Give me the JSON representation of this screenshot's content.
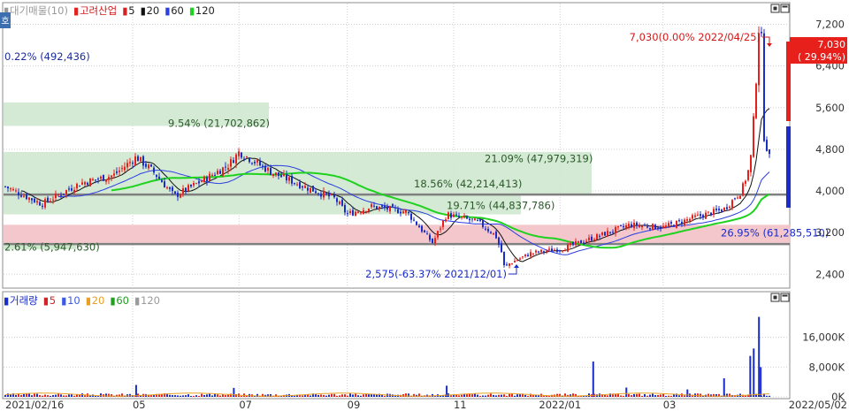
{
  "colors": {
    "up": "#e8201c",
    "down": "#1b2dc8",
    "ma5": "#d42222",
    "ma20": "#111111",
    "ma60": "#2a3ee0",
    "ma120": "#1fd21f",
    "vol10": "#3a5ae8",
    "vol20": "#e8a020",
    "vol60": "#20a020",
    "vol120": "#9a9a9a",
    "profile_band": "#cfe8cf",
    "pink_band": "#f2c4c8",
    "grid": "#cfcfcf",
    "sr_line": "#808080"
  },
  "price_panel": {
    "legend": [
      {
        "marker": "▮",
        "text": "대기매물(10)",
        "color": "#999999"
      },
      {
        "marker": "▮",
        "text": "고려산업",
        "color": "#e8201c"
      },
      {
        "marker": "▮",
        "text": "5",
        "color": "#d42222"
      },
      {
        "marker": "▮",
        "text": "20",
        "color": "#111111"
      },
      {
        "marker": "▮",
        "text": "60",
        "color": "#2a3ee0"
      },
      {
        "marker": "▮",
        "text": "120",
        "color": "#1fd21f"
      }
    ],
    "side_tab": "호",
    "top_left_note": "0.22% (492,436)",
    "profile_labels": [
      {
        "text": "9.54% (21,702,862)",
        "price": 5300
      },
      {
        "text": "21.09% (47,979,319)",
        "price": 4620
      },
      {
        "text": "18.56% (42,214,413)",
        "price": 4140
      },
      {
        "text": "19.71% (44,837,786)",
        "price": 3720
      },
      {
        "text": "2.61% (5,947,630)",
        "price": 2920
      },
      {
        "text": "26.95% (61,285,510)",
        "price": 3190
      }
    ],
    "high_annotation": "7,030(0.00% 2022/04/25)",
    "low_annotation": "2,575(-63.37% 2021/12/01)",
    "price_tag_value": "7,030",
    "price_tag_change": "( 29.94%)"
  },
  "volume_panel": {
    "legend": [
      {
        "marker": "▮",
        "text": "거래량",
        "color": "#1b2dc8"
      },
      {
        "marker": "▮",
        "text": "5",
        "color": "#d42222"
      },
      {
        "marker": "▮",
        "text": "10",
        "color": "#3a5ae8"
      },
      {
        "marker": "▮",
        "text": "20",
        "color": "#e8a020"
      },
      {
        "marker": "▮",
        "text": "60",
        "color": "#20a020"
      },
      {
        "marker": "▮",
        "text": "120",
        "color": "#9a9a9a"
      }
    ]
  },
  "x_axis_labels": [
    "2021/02/16",
    "05",
    "07",
    "09",
    "11",
    "2022/01",
    "03",
    "2022/05/02"
  ],
  "chart_data": [
    {
      "type": "candlestick",
      "title": "고려산업",
      "x_start": "2021-02-16",
      "x_end": "2022-05-02",
      "y_axis_ticks": [
        "7,200",
        "6,400",
        "5,600",
        "4,800",
        "4,000",
        "3,200",
        "2,400"
      ],
      "ylim": [
        2150,
        7600
      ],
      "key_points": [
        {
          "date": "2021-02-16",
          "close": 4100
        },
        {
          "date": "2021-03-10",
          "close": 3750
        },
        {
          "date": "2021-04-01",
          "close": 4150
        },
        {
          "date": "2021-04-20",
          "close": 4300
        },
        {
          "date": "2021-05-03",
          "close": 4650
        },
        {
          "date": "2021-05-12",
          "close": 4400
        },
        {
          "date": "2021-05-25",
          "close": 3900
        },
        {
          "date": "2021-06-10",
          "close": 4200
        },
        {
          "date": "2021-06-25",
          "close": 4500
        },
        {
          "date": "2021-07-01",
          "close": 4750
        },
        {
          "date": "2021-07-20",
          "close": 4350
        },
        {
          "date": "2021-08-10",
          "close": 4050
        },
        {
          "date": "2021-08-25",
          "close": 3850
        },
        {
          "date": "2021-09-01",
          "close": 3550
        },
        {
          "date": "2021-09-15",
          "close": 3700
        },
        {
          "date": "2021-10-05",
          "close": 3600
        },
        {
          "date": "2021-10-20",
          "close": 3000
        },
        {
          "date": "2021-10-28",
          "close": 3550
        },
        {
          "date": "2021-11-15",
          "close": 3400
        },
        {
          "date": "2021-11-25",
          "close": 3150
        },
        {
          "date": "2021-12-01",
          "close": 2575
        },
        {
          "date": "2021-12-15",
          "close": 2800
        },
        {
          "date": "2022-01-03",
          "close": 2900
        },
        {
          "date": "2022-01-20",
          "close": 3100
        },
        {
          "date": "2022-02-10",
          "close": 3350
        },
        {
          "date": "2022-03-01",
          "close": 3300
        },
        {
          "date": "2022-03-20",
          "close": 3500
        },
        {
          "date": "2022-04-05",
          "close": 3650
        },
        {
          "date": "2022-04-15",
          "close": 4000
        },
        {
          "date": "2022-04-20",
          "close": 4500
        },
        {
          "date": "2022-04-22",
          "close": 5410
        },
        {
          "date": "2022-04-25",
          "close": 7030
        },
        {
          "date": "2022-04-26",
          "close": 5300
        },
        {
          "date": "2022-05-02",
          "close": 4500
        }
      ],
      "high": {
        "date": "2022-04-25",
        "value": 7030,
        "pct": "0.00%"
      },
      "low": {
        "date": "2021-12-01",
        "value": 2575,
        "pct": "-63.37%"
      },
      "volume_profile": [
        {
          "from": 5250,
          "to": 5700,
          "pct": "9.54%"
        },
        {
          "from": 3950,
          "to": 4750,
          "pct": "21.09%"
        },
        {
          "from": 3550,
          "to": 3950,
          "pct": "19.71%"
        },
        {
          "from": 3000,
          "to": 3350,
          "pct": "26.95%"
        }
      ],
      "support_resistance_lines": [
        3930,
        2980
      ],
      "moving_averages": [
        "5",
        "20",
        "60",
        "120"
      ]
    },
    {
      "type": "bar",
      "title": "거래량",
      "y_axis_ticks": [
        "16,000K",
        "8,000K",
        "0K"
      ],
      "ylim": [
        0,
        24000
      ],
      "spikes": [
        {
          "date": "2021-05-03",
          "value": 3200
        },
        {
          "date": "2021-06-28",
          "value": 2400
        },
        {
          "date": "2021-10-28",
          "value": 3000
        },
        {
          "date": "2022-01-20",
          "value": 9500
        },
        {
          "date": "2022-02-08",
          "value": 2500
        },
        {
          "date": "2022-03-15",
          "value": 2000
        },
        {
          "date": "2022-04-05",
          "value": 5000
        },
        {
          "date": "2022-04-20",
          "value": 11000
        },
        {
          "date": "2022-04-22",
          "value": 13000
        },
        {
          "date": "2022-04-25",
          "value": 21500
        },
        {
          "date": "2022-04-26",
          "value": 8000
        }
      ]
    }
  ]
}
